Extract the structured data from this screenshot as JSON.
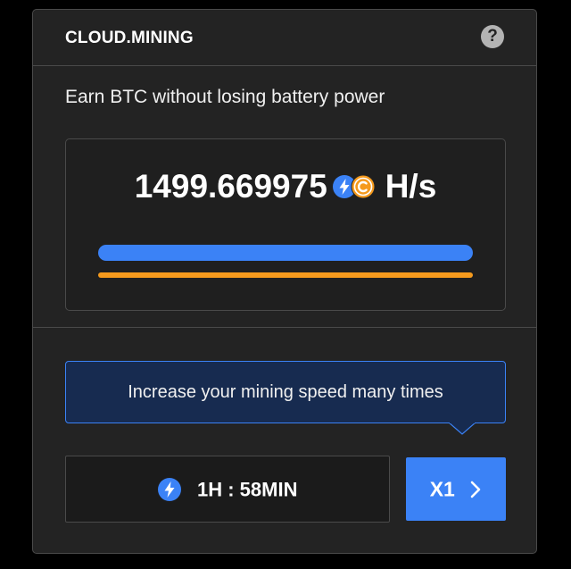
{
  "header": {
    "title": "CLOUD.MINING",
    "help_icon": "question-circle-icon",
    "help_glyph": "?"
  },
  "subtitle": "Earn BTC without losing battery power",
  "hashrate": {
    "value": "1499.669975",
    "unit": "H/s",
    "icons": [
      "lightning-bolt-icon",
      "coin-c-icon"
    ]
  },
  "progress": {
    "blue_bar_fill": 1.0,
    "orange_bar_fill": 1.0
  },
  "tooltip": {
    "text": "Increase your mining speed many times"
  },
  "timer": {
    "icon": "lightning-bolt-icon",
    "text": "1H : 58MIN"
  },
  "boost_button": {
    "label": "X1",
    "icon": "chevron-right-icon"
  },
  "colors": {
    "background": "#000000",
    "card": "#232323",
    "accent_blue": "#3b82f6",
    "accent_orange": "#f59a1d",
    "tooltip_bg": "#172b50",
    "border": "#4a4a4a"
  }
}
